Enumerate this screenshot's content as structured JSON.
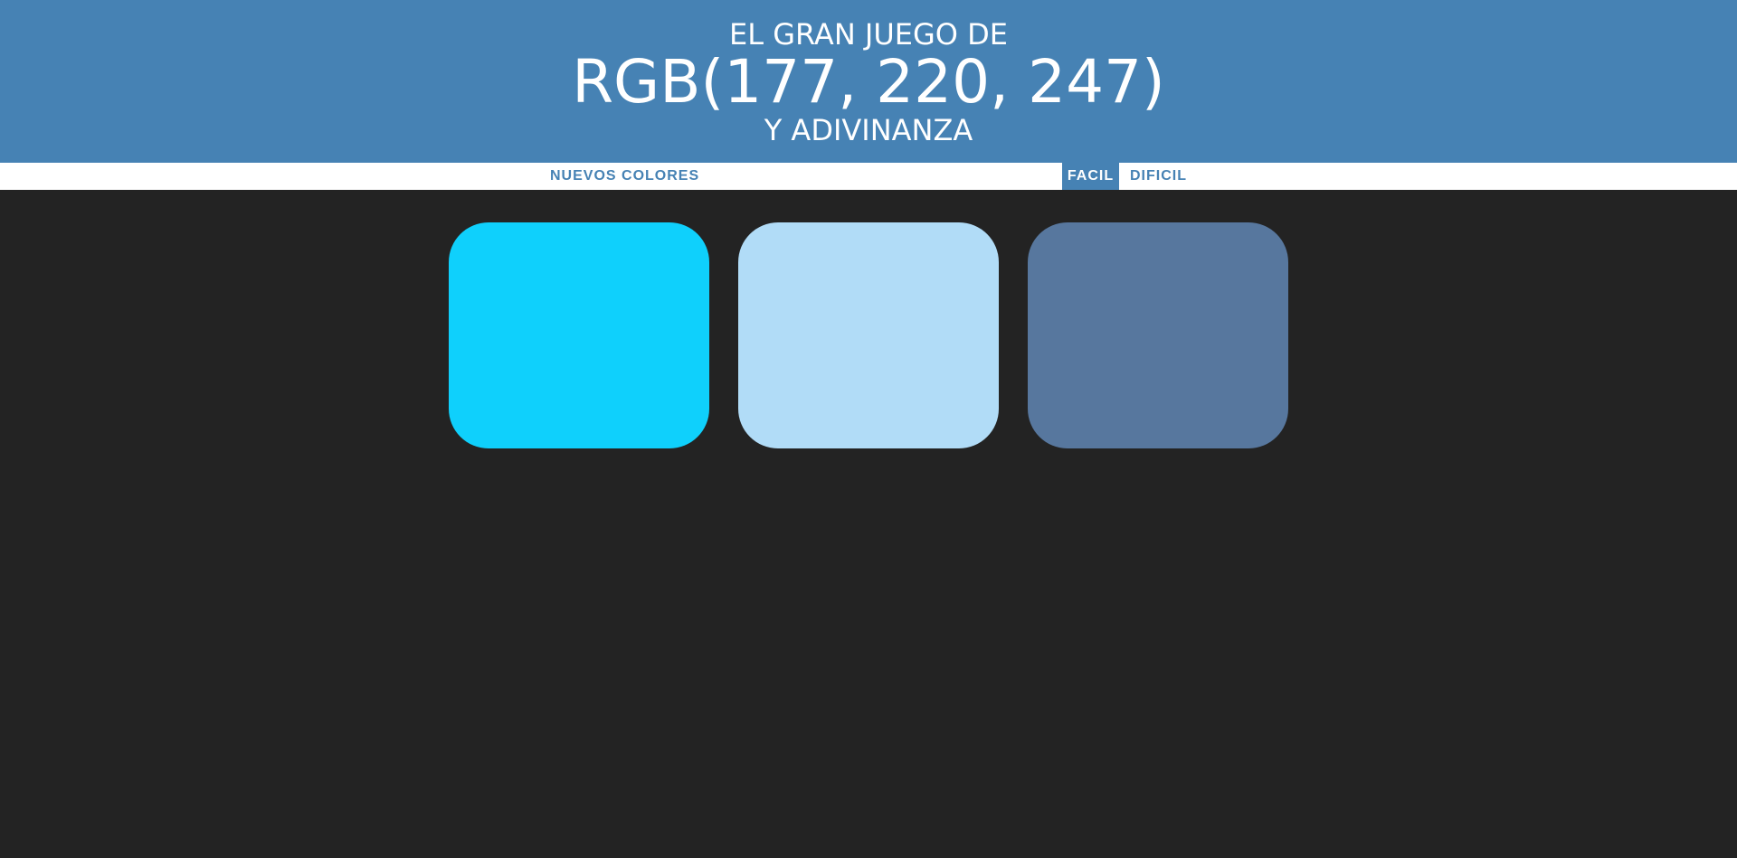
{
  "header": {
    "line1": "EL GRAN JUEGO DE",
    "color_display": "RGB(177, 220, 247)",
    "line3": "Y ADIVINANZA"
  },
  "stripe": {
    "new_colors_label": "NUEVOS COLORES",
    "easy_label": "FACIL",
    "hard_label": "DIFICIL",
    "selected_mode": "FACIL"
  },
  "squares": [
    {
      "color": "#0fd0fc"
    },
    {
      "color": "#b1dcf7"
    },
    {
      "color": "#57779e"
    }
  ],
  "colors": {
    "header_bg": "#4682b4",
    "page_bg": "#232323",
    "stripe_bg": "#ffffff",
    "accent": "#4682b4"
  }
}
